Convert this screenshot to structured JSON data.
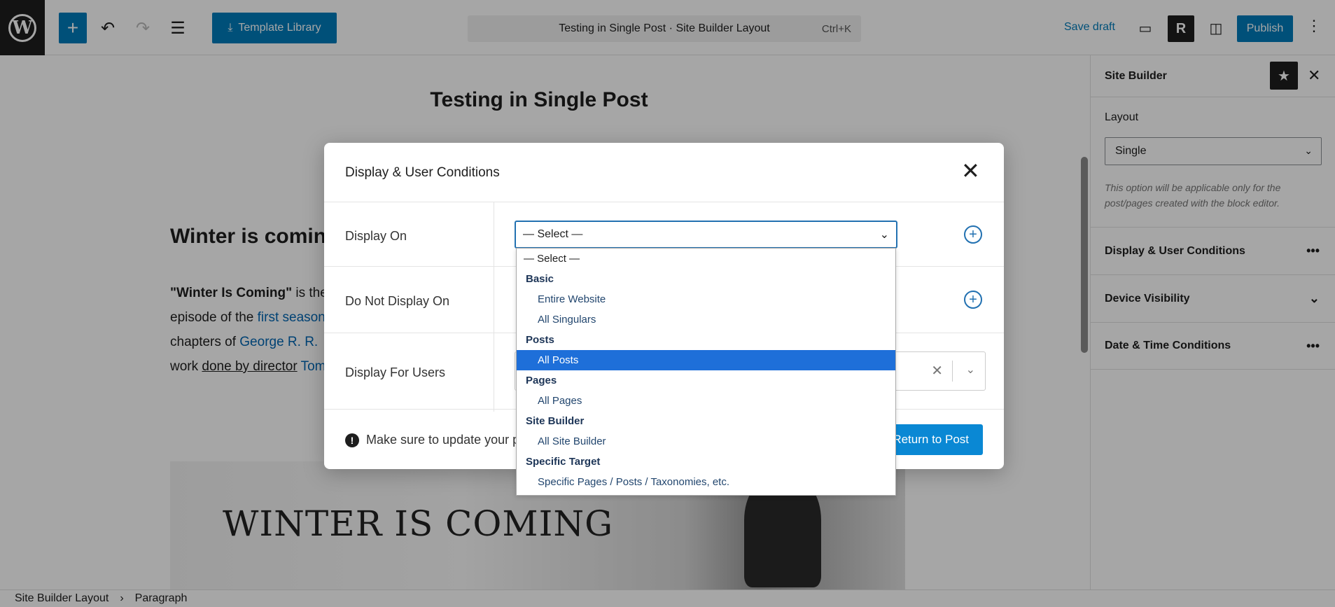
{
  "topbar": {
    "template_library_label": "Template Library",
    "command_title": "Testing in Single Post · Site Builder Layout",
    "command_shortcut": "Ctrl+K",
    "save_draft_label": "Save draft",
    "r_label": "R",
    "publish_label": "Publish"
  },
  "canvas": {
    "post_title": "Testing in Single Post",
    "heading": "Winter is comin",
    "para": {
      "bold": "\"Winter Is Coming\"",
      "t1": " is the",
      "t2": "episode of the ",
      "link1": "first season",
      "t3": "chapters of ",
      "link2": "George R. R.",
      "t4": "work ",
      "und": "done by director",
      "t5": " ",
      "link3": "Tom"
    },
    "hero_text": "WINTER IS COMING"
  },
  "sidebar": {
    "title": "Site Builder",
    "layout_label": "Layout",
    "layout_value": "Single",
    "help_text": "This option will be applicable only for the post/pages created with the block editor.",
    "sections": [
      {
        "label": "Display & User Conditions"
      },
      {
        "label": "Device Visibility"
      },
      {
        "label": "Date & Time Conditions"
      }
    ]
  },
  "footer": {
    "crumb1": "Site Builder Layout",
    "crumb2": "Paragraph"
  },
  "modal": {
    "title": "Display & User Conditions",
    "rows": [
      {
        "label": "Display On"
      },
      {
        "label": "Do Not Display On"
      },
      {
        "label": "Display For Users"
      }
    ],
    "select_value": "— Select —",
    "warning": "Make sure to update your p",
    "return_label": "Return to Post"
  },
  "dropdown": {
    "first": "— Select —",
    "groups": [
      {
        "label": "Basic",
        "options": [
          "Entire Website",
          "All Singulars"
        ]
      },
      {
        "label": "Posts",
        "options": [
          "All Posts"
        ]
      },
      {
        "label": "Pages",
        "options": [
          "All Pages"
        ]
      },
      {
        "label": "Site Builder",
        "options": [
          "All Site Builder"
        ]
      },
      {
        "label": "Specific Target",
        "options": [
          "Specific Pages / Posts / Taxonomies, etc."
        ]
      }
    ],
    "selected": "All Posts"
  },
  "colors": {
    "accent": "#007cba",
    "selected_option": "#1e6fd9",
    "return_button": "#0a88d4"
  }
}
